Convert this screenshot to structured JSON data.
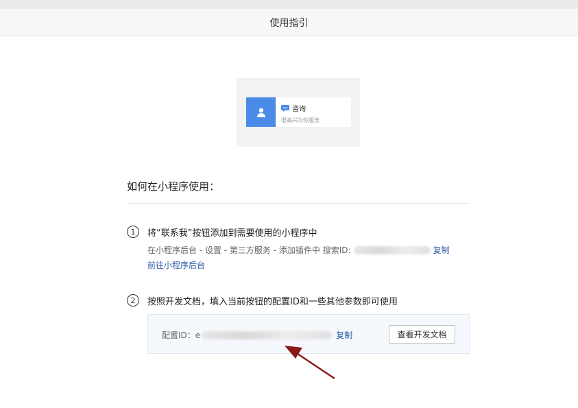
{
  "header": {
    "title": "使用指引"
  },
  "preview": {
    "title": "咨询",
    "subtitle": "很高兴为你服务",
    "colors": {
      "avatar": "#4a8be8",
      "chat_icon": "#4a8be8"
    }
  },
  "section": {
    "title": "如何在小程序使用："
  },
  "step1": {
    "number": "1",
    "title": "将“联系我”按钮添加到需要使用的小程序中",
    "path_text": "在小程序后台 - 设置 - 第三方服务 - 添加插件中 搜索ID:",
    "copy_label": "复制",
    "backend_link": "前往小程序后台"
  },
  "step2": {
    "number": "2",
    "title": "按照开发文档，填入当前按钮的配置ID和一些其他参数即可使用",
    "config_label": "配置ID：",
    "config_prefix": "e",
    "copy_label": "复制",
    "doc_button": "查看开发文档"
  },
  "colors": {
    "link": "#2f5fa8",
    "arrow": "#8b1a1a"
  }
}
